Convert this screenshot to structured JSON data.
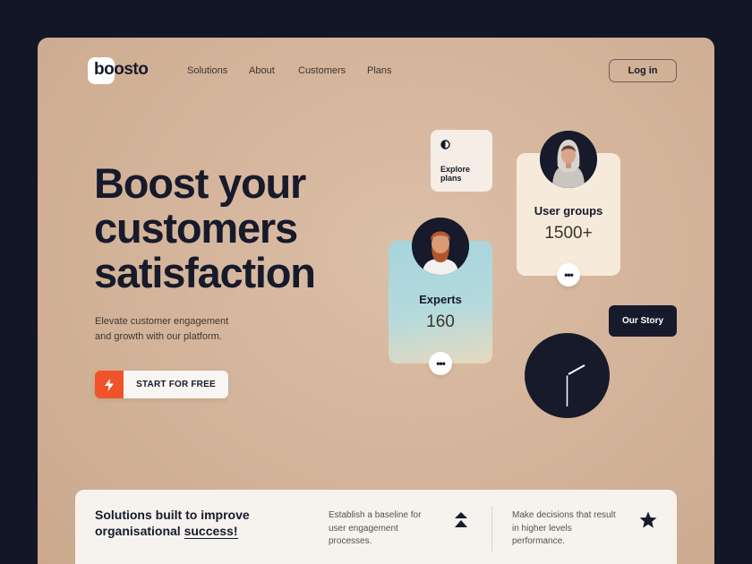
{
  "brand": {
    "logo_text": "boosto"
  },
  "nav": {
    "items": [
      "Solutions",
      "About",
      "Customers",
      "Plans"
    ],
    "login_label": "Log in"
  },
  "hero": {
    "title_lines": [
      "Boost your",
      "customers",
      "satisfaction"
    ],
    "subtitle": "Elevate customer engagement and growth with our platform.",
    "cta_label": "START FOR FREE",
    "cta_icon": "lightning-icon"
  },
  "cards": {
    "explore": {
      "label": "Explore plans",
      "icon": "half-circle-icon"
    },
    "user_groups": {
      "title": "User groups",
      "value": "1500+",
      "menu_icon": "more-dots-icon"
    },
    "experts": {
      "title": "Experts",
      "value": "160",
      "menu_icon": "more-dots-icon"
    }
  },
  "story_label": "Our Story",
  "solutions": {
    "title_part1": "Solutions built to improve organisational ",
    "title_underlined": "success!",
    "features": [
      {
        "text": "Establish a baseline for user engagement processes.",
        "icon": "double-chevron-up-icon"
      },
      {
        "text": "Make decisions that result in higher levels performance.",
        "icon": "star-icon"
      }
    ]
  },
  "colors": {
    "page_bg": "#131626",
    "accent": "#f0532a",
    "dark": "#161a2b",
    "experts_card": "#a6d4dc",
    "user_groups_card": "#f6eadb"
  }
}
